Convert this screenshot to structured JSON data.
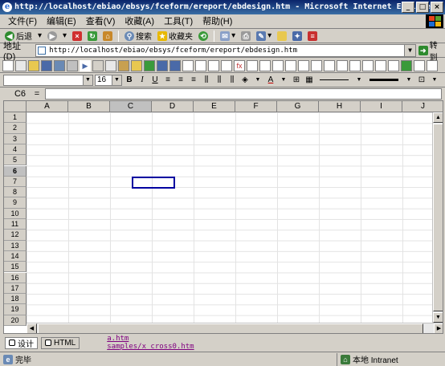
{
  "window": {
    "title": "http://localhost/ebiao/ebsys/fceform/ereport/ebdesign.htm - Microsoft Internet Explorer",
    "minimize": "_",
    "maximize": "□",
    "close": "×"
  },
  "menubar": {
    "items": [
      "文件(F)",
      "编辑(E)",
      "查看(V)",
      "收藏(A)",
      "工具(T)",
      "帮助(H)"
    ]
  },
  "toolbar": {
    "back_label": "后退",
    "search_label": "搜索",
    "favorites_label": "收藏夹"
  },
  "address": {
    "label": "地址(D)",
    "url": "http://localhost/ebiao/ebsys/fceform/ereport/ebdesign.htm",
    "go_label": "转到"
  },
  "format_toolbar": {
    "font_name": "",
    "font_size": "16",
    "bold": "B",
    "italic": "I",
    "underline": "U"
  },
  "formula_bar": {
    "cell_ref": "C6",
    "equals": "=",
    "value": ""
  },
  "sheet": {
    "columns": [
      "A",
      "B",
      "C",
      "D",
      "E",
      "F",
      "G",
      "H",
      "I",
      "J"
    ],
    "rows": [
      "1",
      "2",
      "3",
      "4",
      "5",
      "6",
      "7",
      "8",
      "9",
      "10",
      "11",
      "12",
      "13",
      "14",
      "15",
      "16",
      "17",
      "18",
      "19",
      "20"
    ],
    "active_column": "C",
    "active_row": "6"
  },
  "bottom": {
    "design_tab": "设计",
    "html_tab": "HTML",
    "links": [
      "a.htm",
      "samples/x_cross0.htm"
    ]
  },
  "status": {
    "left": "完毕",
    "right": "本地 Intranet"
  },
  "colors": {
    "title_bar": "#0a246a",
    "active_cell_border": "#0000a0",
    "link_visited": "#800080"
  }
}
